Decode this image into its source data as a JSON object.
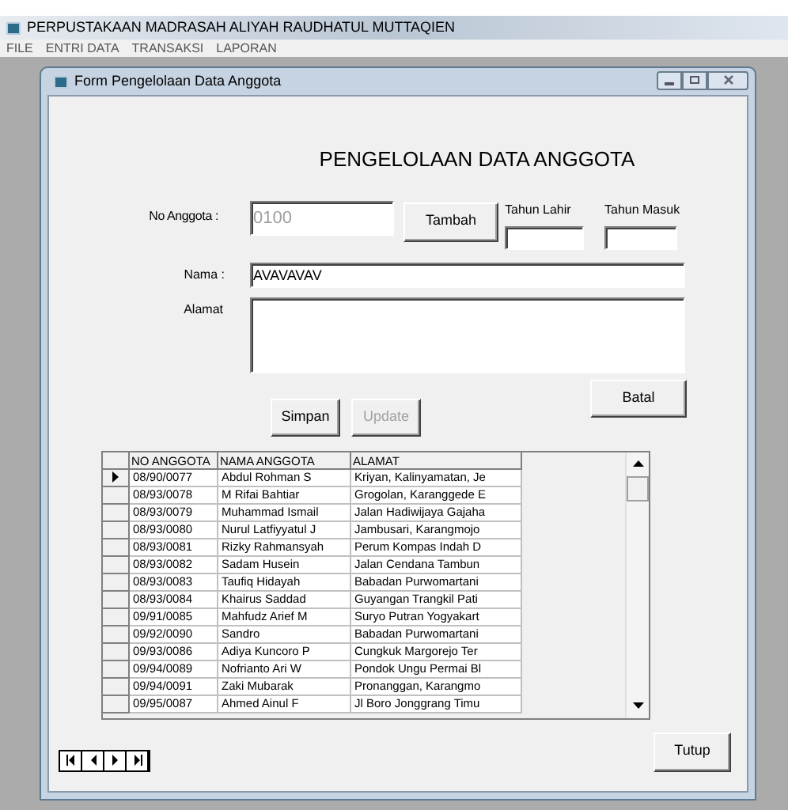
{
  "app": {
    "title": "PERPUSTAKAAN MADRASAH ALIYAH RAUDHATUL MUTTAQIEN"
  },
  "menu": [
    "FILE",
    "ENTRI DATA",
    "TRANSAKSI",
    "LAPORAN"
  ],
  "form": {
    "title": "Form Pengelolaan Data Anggota",
    "heading": "PENGELOLAAN DATA ANGGOTA",
    "no_anggota": {
      "label": "No Anggota :",
      "value": "0100",
      "disabled": true
    },
    "tambah_button": "Tambah",
    "tahun_lahir": {
      "label": "Tahun Lahir"
    },
    "tahun_masuk": {
      "label": "Tahun Masuk"
    },
    "nama": {
      "label": "Nama :",
      "value": "AVAVAVAV"
    },
    "alamat": {
      "label": "Alamat"
    },
    "buttons": [
      {
        "label": "Batal",
        "disabled": false
      },
      {
        "label": "Simpan",
        "disabled": false
      },
      {
        "label": "Update",
        "disabled": true
      }
    ],
    "table": {
      "columns": [
        "NO ANGGOTA",
        "NAMA ANGGOTA",
        "ALAMAT"
      ],
      "rows": [
        {
          "cells": [
            "08/90/0077",
            "Abdul Rohman S",
            "Kriyan, Kalinyamatan, Je"
          ],
          "selected": true
        },
        {
          "cells": [
            "08/93/0078",
            "M Rifai Bahtiar",
            "Grogolan, Karanggede E"
          ],
          "selected": false
        },
        {
          "cells": [
            "08/93/0079",
            "Muhammad Ismail",
            "Jalan Hadiwijaya Gajaha"
          ],
          "selected": false
        },
        {
          "cells": [
            "08/93/0080",
            "Nurul Latfiyyatul J",
            "Jambusari, Karangmojo"
          ],
          "selected": false
        },
        {
          "cells": [
            "08/93/0081",
            "Rizky Rahmansyah",
            "Perum Kompas Indah D"
          ],
          "selected": false
        },
        {
          "cells": [
            "08/93/0082",
            "Sadam Husein",
            "Jalan Cendana Tambun"
          ],
          "selected": false
        },
        {
          "cells": [
            "08/93/0083",
            "Taufiq Hidayah",
            "Babadan Purwomartani"
          ],
          "selected": false
        },
        {
          "cells": [
            "08/93/0084",
            "Khairus Saddad",
            "Guyangan Trangkil Pati"
          ],
          "selected": false
        },
        {
          "cells": [
            "09/91/0085",
            "Mahfudz Arief M",
            "Suryo Putran Yogyakart"
          ],
          "selected": false
        },
        {
          "cells": [
            "09/92/0090",
            "Sandro",
            "Babadan Purwomartani"
          ],
          "selected": false
        },
        {
          "cells": [
            "09/93/0086",
            "Adiya Kuncoro P",
            "Cungkuk Margorejo Ter"
          ],
          "selected": false
        },
        {
          "cells": [
            "09/94/0089",
            "Nofrianto Ari W",
            "Pondok Ungu Permai Bl"
          ],
          "selected": false
        },
        {
          "cells": [
            "09/94/0091",
            "Zaki Mubarak",
            "Pronanggan, Karangmo"
          ],
          "selected": false
        },
        {
          "cells": [
            "09/95/0087",
            "Ahmed Ainul F",
            "Jl Boro Jonggrang Timu"
          ],
          "selected": false
        }
      ]
    },
    "tutup_button": "Tutup"
  }
}
